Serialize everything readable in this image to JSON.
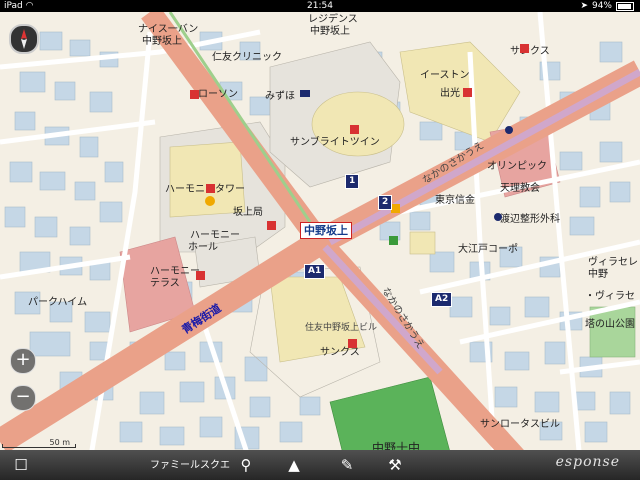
{
  "status_bar": {
    "device": "iPad",
    "time": "21:54",
    "battery": "94%",
    "battery_level": 0.94
  },
  "map": {
    "scale_label": "50 m",
    "crossing_label": "中野坂上",
    "stations": {
      "a1": "A1",
      "a2": "A2",
      "one": "1",
      "two": "2"
    },
    "labels": {
      "naitoban": "ナイス一バン",
      "nakanosakaue_nw": "中野坂上",
      "residence": "レジデンス",
      "nakanosakaue_n": "中野坂上",
      "sankusu_ne": "サンクス",
      "jinyu_clinic": "仁友クリニック",
      "lawson": "ローソン",
      "mizuho": "みずほ",
      "eastone": "イーストン",
      "idemitsu": "出光",
      "sunbright_twin": "サンブライトツイン",
      "harmony_tower": "ハーモニータワー",
      "sakaue_post": "坂上局",
      "harmony_hall_1": "ハーモニー",
      "harmony_hall_2": "ホール",
      "harmony_terrace_1": "ハーモニー",
      "harmony_terrace_2": "テラス",
      "park_heim": "パークハイム",
      "olympic": "オリンピック",
      "tenri_church": "天理教会",
      "tokyo_shinkin": "東京信金",
      "watanabe_clinic": "渡辺整形外科",
      "oedo_coop": "大江戸コーポ",
      "villa_sere": "ヴィラセレ",
      "nakano_label": "中野",
      "villa_sk": "・ヴィラセ",
      "tonoue_park": "塔の山公園",
      "sumitomo_bldg": "住友中野坂上ビル",
      "sankusu_s": "サンクス",
      "sunrotas_bldg": "サンロータスビル",
      "nakano_10": "中野十中",
      "family_mart": "ファミール"
    },
    "roads": {
      "ome_kaido": "青梅街道",
      "nakano_sakaue_e": "なかのさかうえ",
      "nakano_sakaue_s": "なかのさかうえ"
    }
  },
  "toolbar": {
    "bottom_label": "ファミールスクエ",
    "watermark": "esponse"
  },
  "icons": {
    "compass": "compass-icon",
    "zoom_in": "+",
    "zoom_out": "−",
    "bookmark": "bookmark-icon",
    "search": "search-icon",
    "navigate": "navigate-icon",
    "pen": "pen-icon",
    "settings": "wrench-icon"
  }
}
